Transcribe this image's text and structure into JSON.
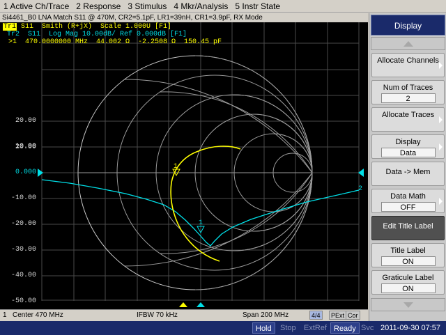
{
  "menu": [
    "1 Active Ch/Trace",
    "2 Response",
    "3 Stimulus",
    "4 Mkr/Analysis",
    "5 Instr State"
  ],
  "title_line": "Si4461_B0 LNA Match S11 @ 470M, CR2=5.1pF, LR1=39nH, CR1=3.9pF, RX Mode",
  "traces": {
    "tr1_badge": "Tr1",
    "tr1_text": " S11  Smith (R+jX)  Scale 1.000U [F1]",
    "tr2_text": "Tr2  S11  Log Mag 10.00dB/ Ref 0.000dB [F1]"
  },
  "marker_readout": ">1  470.0000000 MHz  44.002 Ω  -2.2508 Ω  150.45 pF",
  "y_axis": [
    "20.00",
    "10.00",
    "0.000",
    "-10.00",
    "-20.00",
    "-30.00",
    "-40.00",
    "-50.00"
  ],
  "marker_labels": {
    "tr1_marker": "1",
    "tr2_marker": "1",
    "trace_end": "2"
  },
  "chart_status": {
    "channel": "1",
    "center": "Center 470 MHz",
    "ifbw": "IFBW 70 kHz",
    "span": "Span 200 MHz",
    "points": "4/4",
    "pext": "PExt",
    "cor": "Cor"
  },
  "system_status": [
    "Hold",
    "Stop",
    "ExtRef",
    "Ready",
    "Svc",
    "2011-09-30 07:57"
  ],
  "softkeys": {
    "header": "Display",
    "allocate_channels": "Allocate Channels",
    "num_traces_label": "Num of Traces",
    "num_traces_value": "2",
    "allocate_traces": "Allocate Traces",
    "display_label": "Display",
    "display_value": "Data",
    "data_mem": "Data -> Mem",
    "data_math_label": "Data Math",
    "data_math_value": "OFF",
    "edit_title": "Edit Title Label",
    "title_label_label": "Title Label",
    "title_label_value": "ON",
    "graticule_label_label": "Graticule Label",
    "graticule_label_value": "ON"
  },
  "colors": {
    "trace1": "#ffff00",
    "trace2": "#00e0e8",
    "grid": "#5a5a5a",
    "panel_header": "#1a2a6a"
  }
}
